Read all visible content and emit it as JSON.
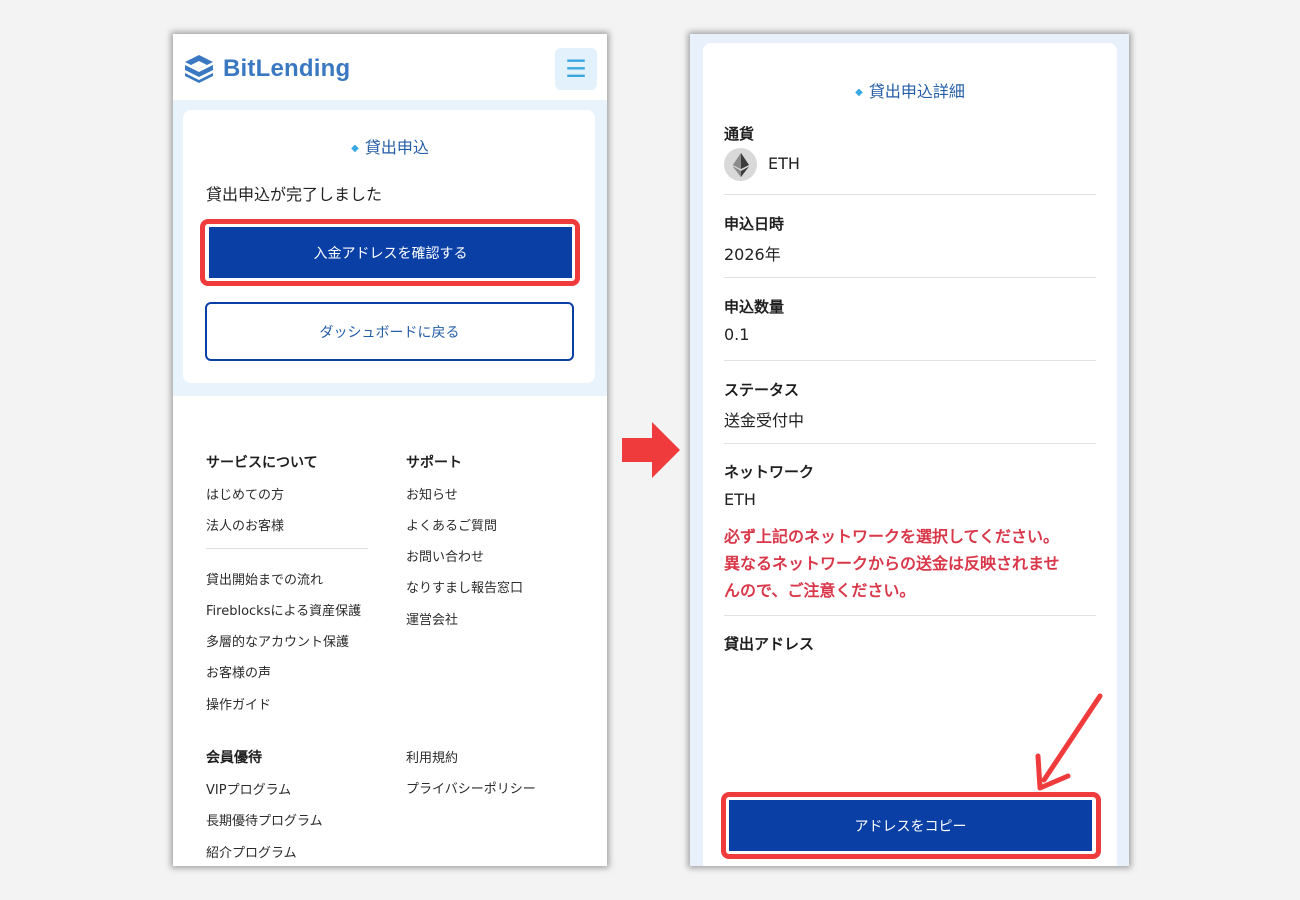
{
  "left_screen": {
    "logo_text": "BitLending",
    "menu_icon": "hamburger-icon",
    "card": {
      "title": "貸出申込",
      "message": "貸出申込が完了しました",
      "primary_button": "入金アドレスを確認する",
      "secondary_button": "ダッシュボードに戻る"
    },
    "footer": {
      "col1_heading": "サービスについて",
      "col1_items": [
        "はじめての方",
        "法人のお客様"
      ],
      "col1_more": [
        "貸出開始までの流れ",
        "Fireblocksによる資産保護",
        "多層的なアカウント保護",
        "お客様の声",
        "操作ガイド"
      ],
      "col2_heading": "サポート",
      "col2_items": [
        "お知らせ",
        "よくあるご質問",
        "お問い合わせ",
        "なりすまし報告窓口",
        "運営会社"
      ],
      "col3_heading": "会員優待",
      "col3_items": [
        "VIPプログラム",
        "長期優待プログラム",
        "紹介プログラム"
      ],
      "col4_items": [
        "利用規約",
        "プライバシーポリシー"
      ]
    }
  },
  "right_screen": {
    "title": "貸出申込詳細",
    "currency_label": "通貨",
    "currency_icon": "ethereum-icon",
    "currency_value": "ETH",
    "date_label": "申込日時",
    "date_value": "2026年",
    "amount_label": "申込数量",
    "amount_value": "0.1",
    "status_label": "ステータス",
    "status_value": "送金受付中",
    "network_label": "ネットワーク",
    "network_value": "ETH",
    "warning_lines": [
      "必ず上記のネットワークを選択してください。",
      "異なるネットワークからの送金は反映されませ",
      "んので、ご注意ください。"
    ],
    "address_label": "貸出アドレス",
    "copy_button": "アドレスをコピー"
  },
  "colors": {
    "primary_button": "#0a3fa6",
    "highlight": "#ef3b3b",
    "brand": "#3a78c2",
    "warning_text": "#d9384a"
  }
}
